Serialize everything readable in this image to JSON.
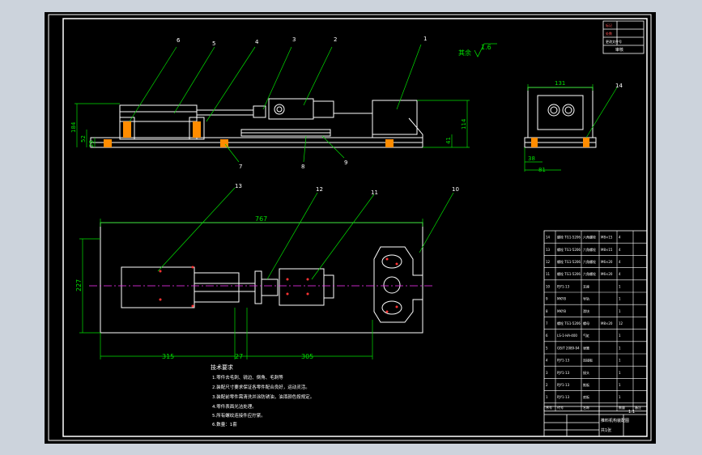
{
  "colors": {
    "viewport_bg": "#ccd3dc",
    "drawing_bg": "#000000",
    "line": "#ffffff",
    "leader": "#00e000",
    "dimension": "#00e000",
    "centerline": "#ff33ff",
    "title_red": "#ff3333"
  },
  "part_numbers": {
    "p1": "1",
    "p2": "2",
    "p3": "3",
    "p4": "4",
    "p5": "5",
    "p6": "6",
    "p7": "7",
    "p8": "8",
    "p9": "9",
    "p10": "10",
    "p11": "11",
    "p12": "12",
    "p13": "13",
    "p14": "14"
  },
  "dimensions": {
    "front_height_a": "184",
    "front_height_b": "52",
    "front_height_c": "28",
    "front_height_right": "114",
    "front_height_small": "41",
    "side_width": "131",
    "side_bottom_a": "38",
    "side_bottom_b": "81",
    "top_length": "767",
    "top_height": "227",
    "bottom_a": "315",
    "bottom_b": "27",
    "bottom_c": "305"
  },
  "roughness": {
    "prefix": "其余",
    "value": "1.6"
  },
  "tech_requirements": {
    "title": "技术要求",
    "lines": [
      "1.零件去毛刺、锐边、倒角、毛刺等",
      "2.装配尺寸要求保证各零件配合良好，运动灵活。",
      "3.装配前零件需清洗并涂防锈油，油漆颜色按规定。",
      "4.零件表面光洁处理。",
      "5.所有螺纹连接件应拧紧。",
      "6.数量：1套"
    ]
  },
  "bom": {
    "rows": [
      {
        "no": "14",
        "code": "螺栓 TG1-5206",
        "name": "六角螺栓",
        "spec": "M8×15",
        "qty": "4",
        "note": ""
      },
      {
        "no": "13",
        "code": "螺栓 TG1-5206",
        "name": "六角螺栓",
        "spec": "M8×15",
        "qty": "4",
        "note": ""
      },
      {
        "no": "12",
        "code": "螺栓 TG1-5206",
        "name": "六角螺栓",
        "spec": "M6×20",
        "qty": "4",
        "note": ""
      },
      {
        "no": "11",
        "code": "螺栓 TG1-5206",
        "name": "六角螺栓",
        "spec": "M6×20",
        "qty": "4",
        "note": ""
      },
      {
        "no": "10",
        "code": "PJY1-13",
        "name": "支座",
        "spec": "",
        "qty": "1",
        "note": ""
      },
      {
        "no": "9",
        "code": "MKY8",
        "name": "导轨",
        "spec": "",
        "qty": "1",
        "note": ""
      },
      {
        "no": "8",
        "code": "MKY8",
        "name": "滑块",
        "spec": "",
        "qty": "1",
        "note": ""
      },
      {
        "no": "7",
        "code": "螺栓 TG1-5206",
        "name": "螺母",
        "spec": "M8×20",
        "qty": "12",
        "note": ""
      },
      {
        "no": "6",
        "code": "LS-1-HA-400",
        "name": "气缸",
        "spec": "",
        "qty": "1",
        "note": ""
      },
      {
        "no": "5",
        "code": "GB/T 2089-94",
        "name": "弹簧",
        "spec": "",
        "qty": "1",
        "note": ""
      },
      {
        "no": "4",
        "code": "PJY1-13",
        "name": "连接板",
        "spec": "",
        "qty": "1",
        "note": ""
      },
      {
        "no": "3",
        "code": "PJY1-13",
        "name": "接头",
        "spec": "",
        "qty": "1",
        "note": ""
      },
      {
        "no": "2",
        "code": "PJY1-13",
        "name": "推板",
        "spec": "",
        "qty": "1",
        "note": ""
      },
      {
        "no": "1",
        "code": "PJY1-13",
        "name": "底板",
        "spec": "",
        "qty": "1",
        "note": ""
      }
    ],
    "header": {
      "no": "序号",
      "code": "代号",
      "name": "名称",
      "qty": "数量",
      "note": "备注"
    }
  },
  "title_block": {
    "drawing_name": "推料机构装配图",
    "scale": "1:1",
    "sheet": "共1张"
  },
  "revision_block": {
    "rows": [
      "标记",
      "处数",
      "更改文件号"
    ],
    "label": "审核"
  }
}
